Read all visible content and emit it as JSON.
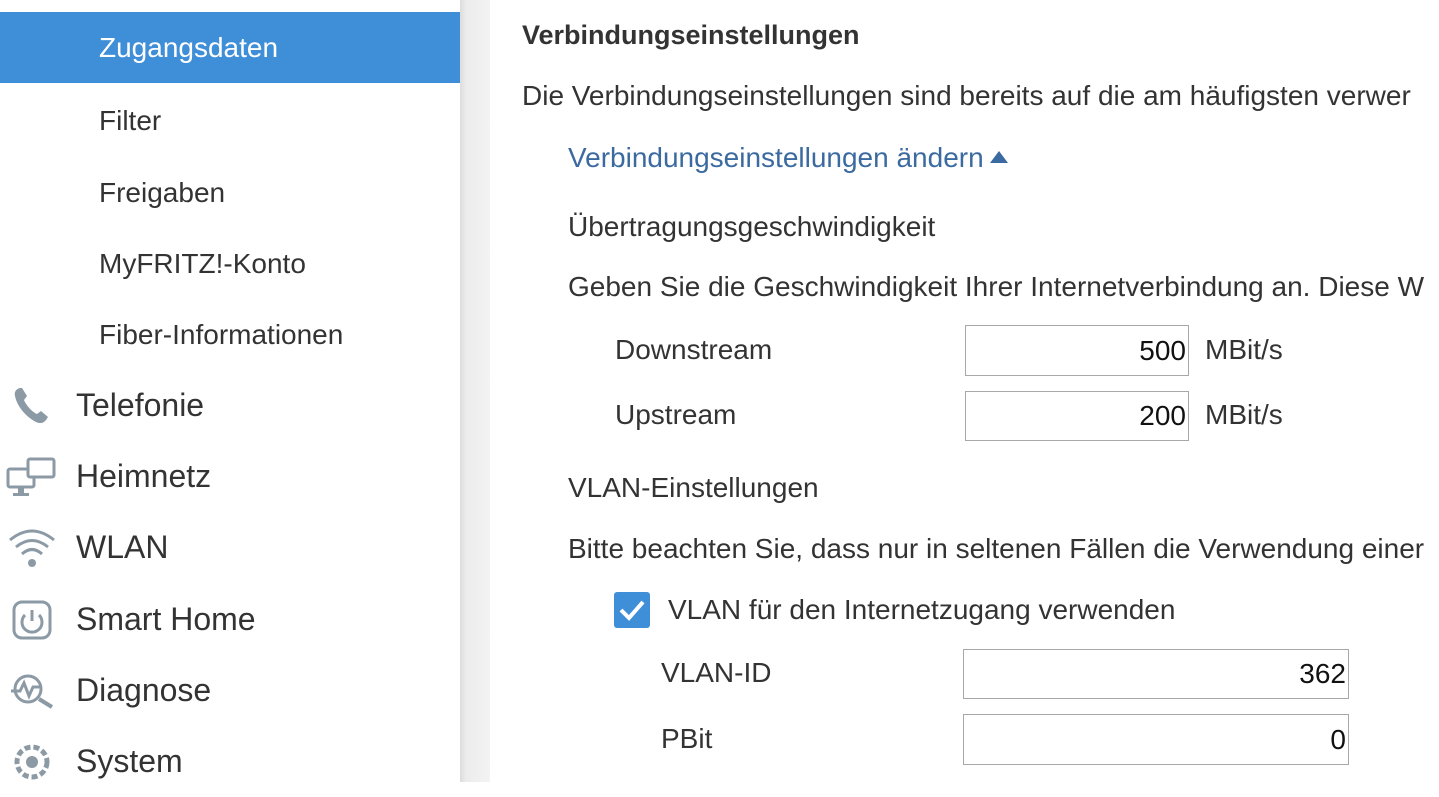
{
  "sidebar": {
    "sub_items": [
      {
        "label": "Zugangsdaten",
        "active": true
      },
      {
        "label": "Filter",
        "active": false
      },
      {
        "label": "Freigaben",
        "active": false
      },
      {
        "label": "MyFRITZ!-Konto",
        "active": false
      },
      {
        "label": "Fiber-Informationen",
        "active": false
      }
    ],
    "main_items": [
      {
        "label": "Telefonie",
        "icon": "phone-icon"
      },
      {
        "label": "Heimnetz",
        "icon": "network-icon"
      },
      {
        "label": "WLAN",
        "icon": "wifi-icon"
      },
      {
        "label": "Smart Home",
        "icon": "smart-home-icon"
      },
      {
        "label": "Diagnose",
        "icon": "diagnose-icon"
      },
      {
        "label": "System",
        "icon": "system-icon"
      }
    ]
  },
  "content": {
    "heading": "Verbindungseinstellungen",
    "intro": "Die Verbindungseinstellungen sind bereits auf die am häufigsten verwer",
    "toggle_link": "Verbindungseinstellungen ändern",
    "speed": {
      "title": "Übertragungsgeschwindigkeit",
      "description": "Geben Sie die Geschwindigkeit Ihrer Internetverbindung an. Diese W",
      "downstream_label": "Downstream",
      "downstream_value": "500",
      "upstream_label": "Upstream",
      "upstream_value": "200",
      "unit": "MBit/s"
    },
    "vlan": {
      "title": "VLAN-Einstellungen",
      "description": "Bitte beachten Sie, dass nur in seltenen Fällen die Verwendung einer",
      "checkbox_label": "VLAN für den Internetzugang verwenden",
      "checkbox_checked": true,
      "id_label": "VLAN-ID",
      "id_value": "362",
      "pbit_label": "PBit",
      "pbit_value": "0"
    }
  },
  "colors": {
    "accent": "#3f8ed8",
    "link": "#3b6aa0",
    "text": "#333333"
  }
}
